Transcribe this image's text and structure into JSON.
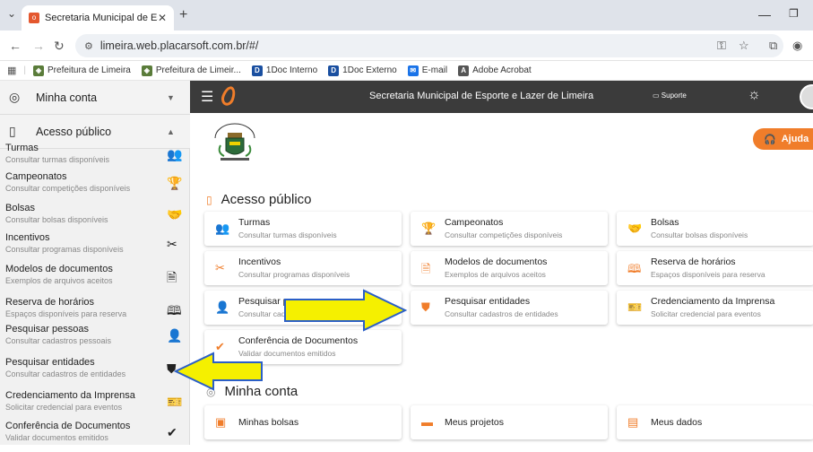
{
  "browser": {
    "tab_title": "Secretaria Municipal de Esporte",
    "url": "limeira.web.placarsoft.com.br/#/",
    "bookmarks": [
      {
        "label": "Prefeitura de Limeira",
        "icon": "crest-icon",
        "color": "#5a7c3a"
      },
      {
        "label": "Prefeitura de Limeir...",
        "icon": "crest-icon",
        "color": "#5a7c3a"
      },
      {
        "label": "1Doc Interno",
        "icon": "d-icon",
        "color": "#1a4fa0"
      },
      {
        "label": "1Doc Externo",
        "icon": "d-icon",
        "color": "#1a4fa0"
      },
      {
        "label": "E-mail",
        "icon": "mail-icon",
        "color": "#1a73e8"
      },
      {
        "label": "Adobe Acrobat",
        "icon": "acrobat-icon",
        "color": "#555555"
      }
    ]
  },
  "sidebar": {
    "minha_conta": "Minha conta",
    "acesso_publico": "Acesso público",
    "items": [
      {
        "title": "Turmas",
        "subtitle": "Consultar turmas disponíveis",
        "icon": "people-icon",
        "glyph": "👥"
      },
      {
        "title": "Campeonatos",
        "subtitle": "Consultar competições disponíveis",
        "icon": "trophy-icon",
        "glyph": "🏆"
      },
      {
        "title": "Bolsas",
        "subtitle": "Consultar bolsas disponíveis",
        "icon": "grant-icon",
        "glyph": "🤝"
      },
      {
        "title": "Incentivos",
        "subtitle": "Consultar programas disponíveis",
        "icon": "incentive-icon",
        "glyph": "✂"
      },
      {
        "title": "Modelos de documentos",
        "subtitle": "Exemplos de arquivos aceitos",
        "icon": "document-icon",
        "glyph": "🗎"
      },
      {
        "title": "Reserva de horários",
        "subtitle": "Espaços disponíveis para reserva",
        "icon": "book-icon",
        "glyph": "🕮"
      },
      {
        "title": "Pesquisar pessoas",
        "subtitle": "Consultar cadastros pessoais",
        "icon": "person-search-icon",
        "glyph": "👤"
      },
      {
        "title": "Pesquisar entidades",
        "subtitle": "Consultar cadastros de entidades",
        "icon": "shield-icon",
        "glyph": "⛊"
      },
      {
        "title": "Credenciamento da Imprensa",
        "subtitle": "Solicitar credencial para eventos",
        "icon": "badge-icon",
        "glyph": "🎫"
      },
      {
        "title": "Conferência de Documentos",
        "subtitle": "Validar documentos emitidos",
        "icon": "check-circle-icon",
        "glyph": "✔"
      }
    ]
  },
  "appbar": {
    "title": "Secretaria Municipal de Esporte e Lazer de Limeira",
    "support": "Suporte"
  },
  "main": {
    "ajuda": "Ajuda",
    "section_public": "Acesso público",
    "section_account": "Minha conta",
    "cards": [
      {
        "title": "Turmas",
        "subtitle": "Consultar turmas disponíveis",
        "icon": "people-icon",
        "glyph": "👥"
      },
      {
        "title": "Campeonatos",
        "subtitle": "Consultar competições disponíveis",
        "icon": "trophy-icon",
        "glyph": "🏆"
      },
      {
        "title": "Bolsas",
        "subtitle": "Consultar bolsas disponíveis",
        "icon": "grant-icon",
        "glyph": "🤝"
      },
      {
        "title": "Incentivos",
        "subtitle": "Consultar programas disponíveis",
        "icon": "incentive-icon",
        "glyph": "✂"
      },
      {
        "title": "Modelos de documentos",
        "subtitle": "Exemplos de arquivos aceitos",
        "icon": "document-icon",
        "glyph": "🗎"
      },
      {
        "title": "Reserva de horários",
        "subtitle": "Espaços disponíveis para reserva",
        "icon": "book-icon",
        "glyph": "🕮"
      },
      {
        "title": "Pesquisar pessoas",
        "subtitle": "Consultar cadastros",
        "icon": "person-search-icon",
        "glyph": "👤"
      },
      {
        "title": "Pesquisar entidades",
        "subtitle": "Consultar cadastros de entidades",
        "icon": "shield-icon",
        "glyph": "⛊"
      },
      {
        "title": "Credenciamento da Imprensa",
        "subtitle": "Solicitar credencial para eventos",
        "icon": "badge-icon",
        "glyph": "🎫"
      },
      {
        "title": "Conferência de Documentos",
        "subtitle": "Validar documentos emitidos",
        "icon": "check-circle-icon",
        "glyph": "✔"
      }
    ],
    "account_cards": [
      {
        "title": "Minhas bolsas",
        "icon": "wallet-icon",
        "glyph": "▣"
      },
      {
        "title": "Meus projetos",
        "icon": "folder-icon",
        "glyph": "▬"
      },
      {
        "title": "Meus dados",
        "icon": "id-card-icon",
        "glyph": "▤"
      }
    ]
  },
  "colors": {
    "accent": "#f07d2a",
    "appbar": "#3b3b3b",
    "arrow": "#f5f000",
    "arrow_border": "#2b5fc7"
  }
}
